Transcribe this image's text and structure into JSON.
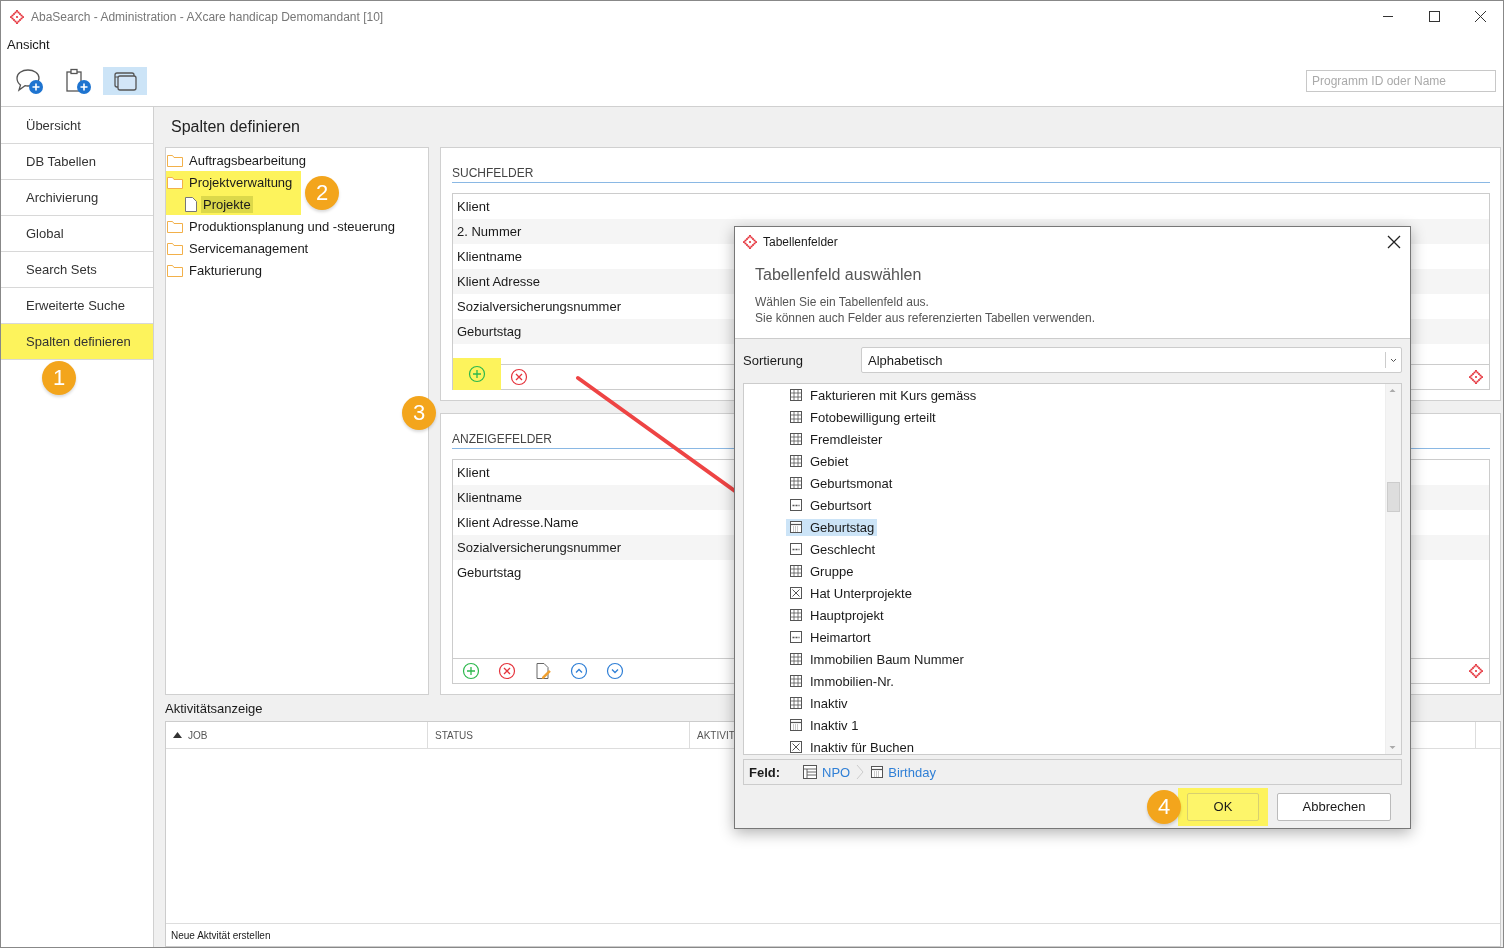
{
  "window": {
    "title": "AbaSearch - Administration - AXcare handicap Demomandant [10]"
  },
  "menu": [
    "Ansicht"
  ],
  "toolbar": {
    "buttons": [
      {
        "kind": "comment-add",
        "selected": false
      },
      {
        "kind": "clipboard-add",
        "selected": false
      },
      {
        "kind": "windows",
        "selected": true
      }
    ],
    "search": {
      "placeholder": "Programm ID oder Name"
    }
  },
  "nav": [
    {
      "label": "Übersicht",
      "selected": false
    },
    {
      "label": "DB Tabellen",
      "selected": false
    },
    {
      "label": "Archivierung",
      "selected": false
    },
    {
      "label": "Global",
      "selected": false
    },
    {
      "label": "Search Sets",
      "selected": false
    },
    {
      "label": "Erweiterte Suche",
      "selected": false
    },
    {
      "label": "Spalten definieren",
      "selected": true
    }
  ],
  "page_title": "Spalten definieren",
  "tree": [
    {
      "label": "Auftragsbearbeitung",
      "selected": false,
      "highlighted": false
    },
    {
      "label": "Projektverwaltung",
      "selected": false,
      "highlighted": true,
      "children": [
        {
          "label": "Projekte",
          "selected": true,
          "highlighted": true
        }
      ]
    },
    {
      "label": "Produktionsplanung und -steuerung",
      "selected": false,
      "highlighted": false
    },
    {
      "label": "Servicemanagement",
      "selected": false,
      "highlighted": false
    },
    {
      "label": "Fakturierung",
      "selected": false,
      "highlighted": false
    }
  ],
  "search_fields": {
    "title": "SUCHFELDER",
    "rows": [
      "Klient",
      "2. Nummer",
      "Klientname",
      "Klient Adresse",
      "Sozialversicherungsnummer",
      "Geburtstag"
    ],
    "actions": [
      {
        "kind": "add",
        "highlighted": true
      },
      {
        "kind": "remove",
        "highlighted": false
      }
    ]
  },
  "display_fields": {
    "title": "ANZEIGEFELDER",
    "rows": [
      "Klient",
      "Klientname",
      "Klient Adresse.Name",
      "Sozialversicherungsnummer",
      "Geburtstag"
    ],
    "actions": [
      {
        "kind": "add",
        "highlighted": false
      },
      {
        "kind": "remove",
        "highlighted": false
      },
      {
        "kind": "edit",
        "highlighted": false
      },
      {
        "kind": "up",
        "highlighted": false
      },
      {
        "kind": "down",
        "highlighted": false
      }
    ]
  },
  "activity": {
    "title": "Aktivitätsanzeige",
    "columns": [
      {
        "label": "JOB",
        "sorted": true
      },
      {
        "label": "STATUS",
        "sorted": false
      },
      {
        "label": "AKTIVIT",
        "sorted": false
      }
    ],
    "footer": "Neue Aktvität erstellen"
  },
  "dialog": {
    "title": "Tabellenfelder",
    "heading": "Tabellenfeld auswählen",
    "description": [
      "Wählen Sie ein Tabellenfeld aus.",
      "Sie können auch Felder aus referenzierten Tabellen verwenden."
    ],
    "sort_label": "Sortierung",
    "sort_value": "Alphabetisch",
    "fields": [
      {
        "label": "Fakturieren mit Kurs gemäss",
        "kind": "grid",
        "selected": false
      },
      {
        "label": "Fotobewilligung erteilt",
        "kind": "grid",
        "selected": false
      },
      {
        "label": "Fremdleister",
        "kind": "grid",
        "selected": false
      },
      {
        "label": "Gebiet",
        "kind": "grid",
        "selected": false
      },
      {
        "label": "Geburtsmonat",
        "kind": "grid",
        "selected": false
      },
      {
        "label": "Geburtsort",
        "kind": "text",
        "selected": false
      },
      {
        "label": "Geburtstag",
        "kind": "date",
        "selected": true
      },
      {
        "label": "Geschlecht",
        "kind": "text",
        "selected": false
      },
      {
        "label": "Gruppe",
        "kind": "grid",
        "selected": false
      },
      {
        "label": "Hat Unterprojekte",
        "kind": "bool",
        "selected": false
      },
      {
        "label": "Hauptprojekt",
        "kind": "grid",
        "selected": false
      },
      {
        "label": "Heimartort",
        "kind": "text",
        "selected": false
      },
      {
        "label": "Immobilien Baum Nummer",
        "kind": "grid",
        "selected": false
      },
      {
        "label": "Immobilien-Nr.",
        "kind": "grid",
        "selected": false
      },
      {
        "label": "Inaktiv",
        "kind": "grid",
        "selected": false
      },
      {
        "label": "Inaktiv 1",
        "kind": "date",
        "selected": false
      },
      {
        "label": "Inaktiv für Buchen",
        "kind": "bool",
        "selected": false
      }
    ],
    "path_label": "Feld:",
    "path": [
      {
        "kind": "table",
        "label": "NPO"
      },
      {
        "kind": "date",
        "label": "Birthday"
      }
    ],
    "buttons": [
      {
        "label": "OK",
        "highlighted": true
      },
      {
        "label": "Abbrechen",
        "highlighted": false
      }
    ]
  },
  "callouts": [
    "1",
    "2",
    "3",
    "4"
  ]
}
